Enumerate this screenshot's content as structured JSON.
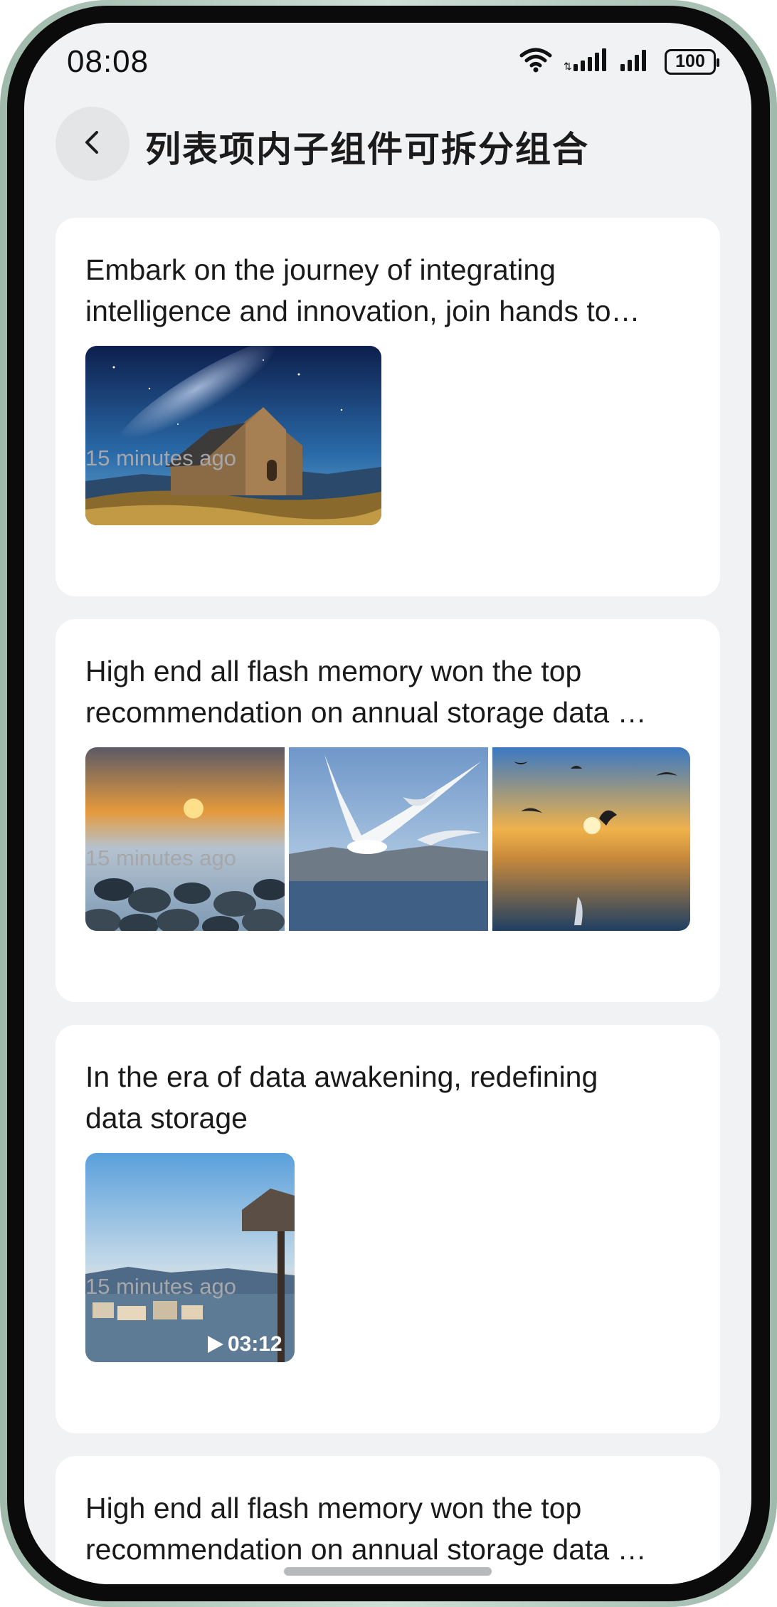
{
  "status_bar": {
    "time": "08:08",
    "battery": "100",
    "icons": [
      "wifi-icon",
      "signal-icon",
      "signal-icon",
      "battery-icon"
    ]
  },
  "header": {
    "title": "列表项内子组件可拆分组合",
    "back_icon": "chevron-left-icon"
  },
  "cards": [
    {
      "title_lines": [
        "Embark on the journey of integrating",
        "intelligence and innovation, join hands to…"
      ],
      "time": "15 minutes ago",
      "images": [
        "starry-church-image"
      ]
    },
    {
      "title_lines": [
        "High end all flash memory won the top",
        "recommendation on annual storage data …"
      ],
      "time": "15 minutes ago",
      "images": [
        "sunset-pebbles-image",
        "seagulls-image",
        "sunset-seagulls-image"
      ]
    },
    {
      "title_lines": [
        "In the era of data awakening, redefining",
        "data storage"
      ],
      "time": "15 minutes ago",
      "video": {
        "duration": "03:12",
        "icon": "play-icon"
      }
    },
    {
      "title_lines": [
        "High end all flash memory won the top",
        "recommendation on annual storage data …"
      ]
    }
  ]
}
